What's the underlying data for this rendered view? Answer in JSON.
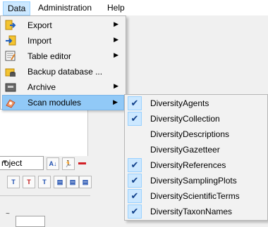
{
  "menubar": {
    "data": "Data",
    "administration": "Administration",
    "help": "Help"
  },
  "data_menu": {
    "items": [
      {
        "label": "Export",
        "icon": "export-icon",
        "submenu": true
      },
      {
        "label": "Import",
        "icon": "import-icon",
        "submenu": true
      },
      {
        "label": "Table editor",
        "icon": "table-editor-icon",
        "submenu": true
      },
      {
        "label": "Backup database ...",
        "icon": "backup-database-icon",
        "submenu": false
      },
      {
        "label": "Archive",
        "icon": "archive-icon",
        "submenu": true
      },
      {
        "label": "Scan modules",
        "icon": "scan-modules-icon",
        "submenu": true,
        "highlighted": true
      }
    ],
    "submenu_arrow": "▶"
  },
  "scan_modules_submenu": {
    "check_glyph": "✔",
    "items": [
      {
        "label": "DiversityAgents",
        "checked": true
      },
      {
        "label": "DiversityCollection",
        "checked": true
      },
      {
        "label": "DiversityDescriptions",
        "checked": false
      },
      {
        "label": "DiversityGazetteer",
        "checked": false
      },
      {
        "label": "DiversityReferences",
        "checked": true
      },
      {
        "label": "DiversitySamplingPlots",
        "checked": true
      },
      {
        "label": "DiversityScientificTerms",
        "checked": true
      },
      {
        "label": "DiversityTaxonNames",
        "checked": true
      }
    ]
  },
  "background": {
    "project_combo": "roject",
    "lower_panel_prefix": "~"
  },
  "colors": {
    "menu_highlight": "#91c9f7",
    "check_bg": "#cce8ff"
  }
}
